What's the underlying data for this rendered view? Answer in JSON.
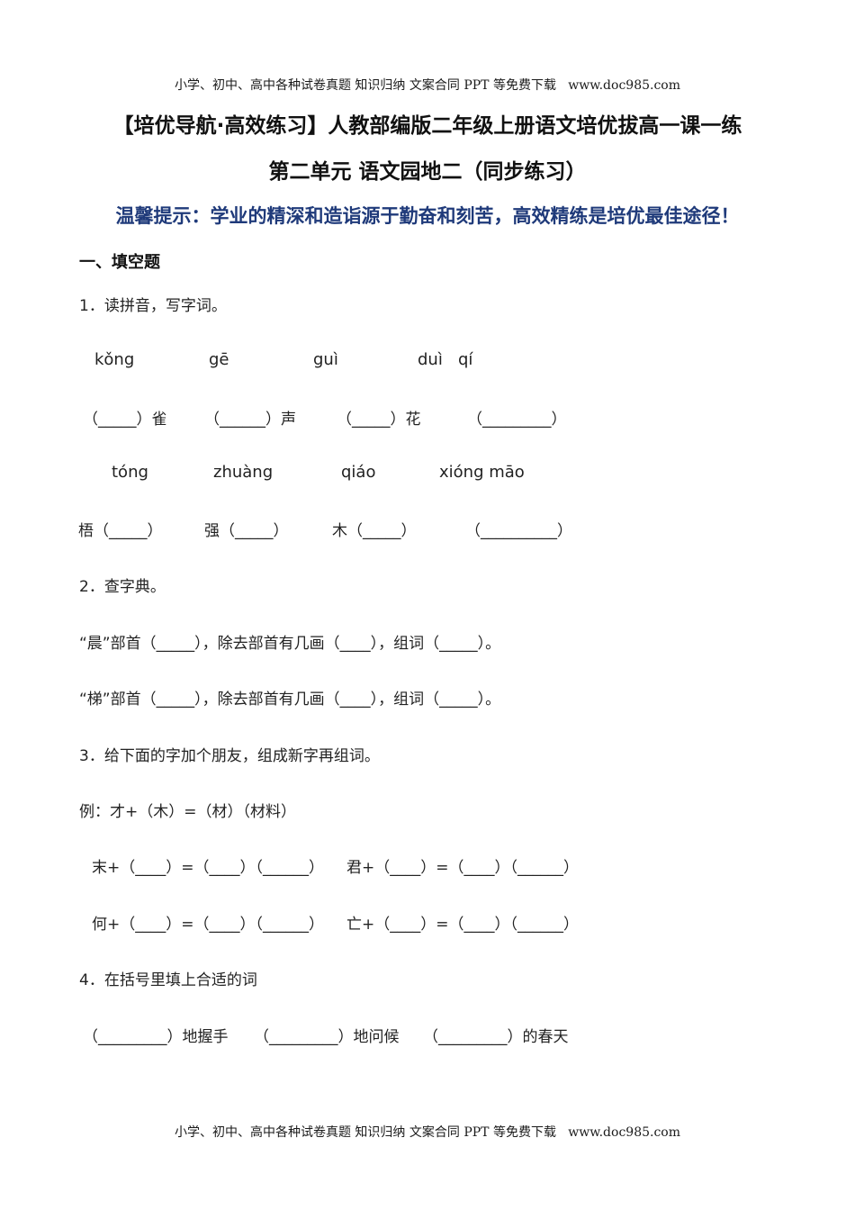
{
  "page": {
    "banner_top": "小学、初中、高中各种试卷真题 知识归纳 文案合同 PPT 等免费下载   www.doc985.com",
    "banner_bottom": "小学、初中、高中各种试卷真题 知识归纳 文案合同 PPT 等免费下载   www.doc985.com",
    "title_line1": "【培优导航·高效练习】人教部编版二年级上册语文培优拔高一课一练",
    "title_line2": "第二单元 语文园地二（同步练习）",
    "tip": "温馨提示：学业的精深和造诣源于勤奋和刻苦，高效精练是培优最佳途径！",
    "tip_color": "#1f3a7a"
  },
  "section1": {
    "heading": "一、填空题"
  },
  "q1": {
    "prompt": "1．读拼音，写字词。",
    "pinyin_row1": [
      "kǒng",
      "gē",
      "guì",
      "duì   qí"
    ],
    "blank_row1": [
      "（_____）雀",
      "（______）声",
      "（_____）花",
      "（_________）"
    ],
    "pinyin_row2": [
      "tóng",
      "zhuàng",
      "qiáo",
      "xióng māo"
    ],
    "blank_row2": [
      "梧（_____）",
      "强（_____）",
      "木（_____）",
      "（__________）"
    ]
  },
  "q2": {
    "prompt": "2．查字典。",
    "lines": [
      "“晨”部首（_____），除去部首有几画（____），组词（_____）。",
      "“梯”部首（_____），除去部首有几画（____），组词（_____）。"
    ]
  },
  "q3": {
    "prompt": "3．给下面的字加个朋友，组成新字再组词。",
    "example": "例：才+（木）=（材）（材料）",
    "rows": [
      [
        "末+（____）=（____）（______）",
        "君+（____）=（____）（______）"
      ],
      [
        "何+（____）=（____）（______）",
        "亡+（____）=（____）（______）"
      ]
    ]
  },
  "q4": {
    "prompt": "4．在括号里填上合适的词",
    "items": [
      "（_________）地握手",
      "（_________）地问候",
      "（_________）的春天"
    ]
  }
}
